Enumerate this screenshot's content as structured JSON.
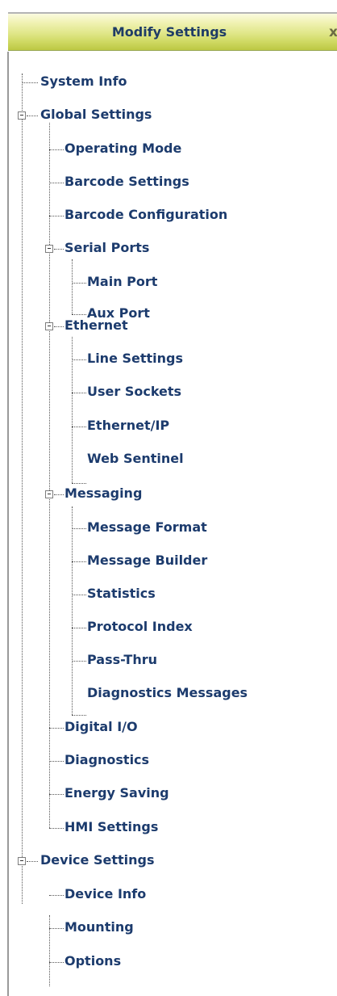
{
  "header": {
    "title": "Modify Settings",
    "close_glyph": "x"
  },
  "tree": {
    "system_info": "System Info",
    "global_settings": "Global Settings",
    "operating_mode": "Operating Mode",
    "barcode_settings": "Barcode Settings",
    "barcode_configuration": "Barcode Configuration",
    "serial_ports": "Serial Ports",
    "main_port": "Main Port",
    "aux_port": "Aux Port",
    "ethernet": "Ethernet",
    "line_settings": "Line Settings",
    "user_sockets": "User Sockets",
    "ethernet_ip": "Ethernet/IP",
    "web_sentinel": "Web Sentinel",
    "messaging": "Messaging",
    "message_format": "Message Format",
    "message_builder": "Message Builder",
    "statistics": "Statistics",
    "protocol_index": "Protocol Index",
    "pass_thru": "Pass-Thru",
    "diagnostics_messages": "Diagnostics Messages",
    "digital_io": "Digital I/O",
    "diagnostics": "Diagnostics",
    "energy_saving": "Energy Saving",
    "hmi_settings": "HMI Settings",
    "device_settings": "Device Settings",
    "device_info": "Device Info",
    "mounting": "Mounting",
    "options": "Options"
  },
  "colors": {
    "header_gradient_top": "#fbfbe0",
    "header_gradient_bottom": "#bcc843",
    "header_text": "#1f3c66",
    "tree_text": "#1c3b6d"
  }
}
